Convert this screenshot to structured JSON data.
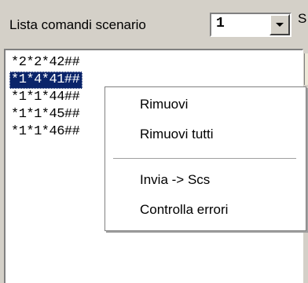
{
  "header": {
    "label": "Lista comandi scenario",
    "scenario_value": "1",
    "cut_label": "S"
  },
  "list": {
    "items": [
      "*2*2*42##",
      "*1*4*41##",
      "*1*1*44##",
      "*1*1*45##",
      "*1*1*46##"
    ],
    "selected_index": 1
  },
  "context_menu": {
    "items": [
      "Rimuovi",
      "Rimuovi tutti",
      "Invia -> Scs",
      "Controlla errori"
    ]
  }
}
